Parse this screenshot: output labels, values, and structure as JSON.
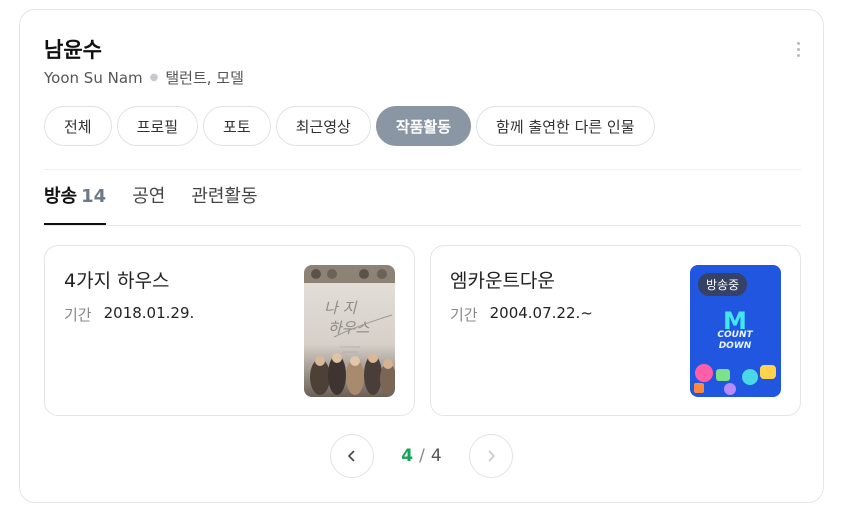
{
  "person": {
    "name": "남윤수",
    "name_en": "Yoon Su Nam",
    "roles": "탤런트, 모델"
  },
  "tabs": [
    {
      "label": "전체",
      "active": false
    },
    {
      "label": "프로필",
      "active": false
    },
    {
      "label": "포토",
      "active": false
    },
    {
      "label": "최근영상",
      "active": false
    },
    {
      "label": "작품활동",
      "active": true
    },
    {
      "label": "함께 출연한 다른 인물",
      "active": false
    }
  ],
  "subtabs": [
    {
      "label": "방송",
      "count": "14",
      "active": true
    },
    {
      "label": "공연",
      "count": "",
      "active": false
    },
    {
      "label": "관련활동",
      "count": "",
      "active": false
    }
  ],
  "works": [
    {
      "title": "4가지 하우스",
      "period_label": "기간",
      "period_value": "2018.01.29.",
      "badge": "",
      "poster_text": "나 4가지 하우스"
    },
    {
      "title": "엠카운트다운",
      "period_label": "기간",
      "period_value": "2004.07.22.~",
      "badge": "방송중",
      "poster_text": "M COUNT DOWN"
    }
  ],
  "pager": {
    "current": "4",
    "total": "4",
    "separator": "/"
  },
  "colors": {
    "active_tab": "#8a96a3",
    "current_page": "#15a356",
    "countdown_bg": "#1d4fd8"
  }
}
